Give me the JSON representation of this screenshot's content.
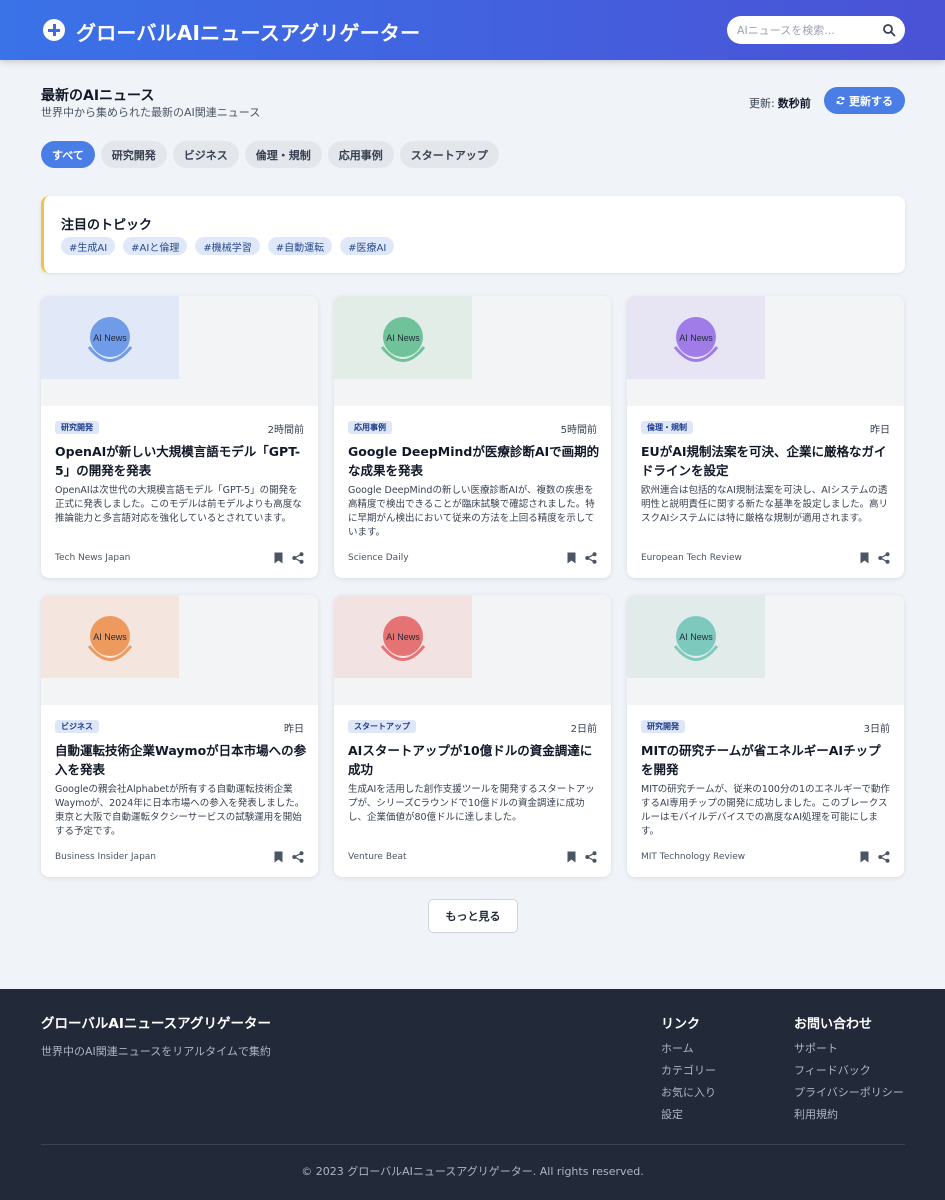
{
  "header": {
    "title": "グローバルAIニュースアグリゲーター",
    "search_placeholder": "AIニュースを検索..."
  },
  "section": {
    "title": "最新のAIニュース",
    "subtitle": "世界中から集められた最新のAI関連ニュース",
    "updated_label": "更新:",
    "updated_value": "数秒前",
    "refresh_label": "更新する"
  },
  "filters": [
    "すべて",
    "研究開発",
    "ビジネス",
    "倫理・規制",
    "応用事例",
    "スタートアップ"
  ],
  "trending": {
    "title": "注目のトピック",
    "tags": [
      "#生成AI",
      "#AIと倫理",
      "#機械学習",
      "#自動運転",
      "#医療AI"
    ]
  },
  "articles": [
    {
      "category": "研究開発",
      "time": "2時間前",
      "title": "OpenAIが新しい大規模言語モデル「GPT-5」の開発を発表",
      "description": "OpenAIは次世代の大規模言語モデル「GPT-5」の開発を正式に発表しました。このモデルは前モデルよりも高度な推論能力と多言語対応を強化しているとされています。",
      "source": "Tech News Japan",
      "thumb_label": "AI News",
      "thumb_bg": "#e1e8f8",
      "thumb_color": "#6f9be8"
    },
    {
      "category": "応用事例",
      "time": "5時間前",
      "title": "Google DeepMindが医療診断AIで画期的な成果を発表",
      "description": "Google DeepMindの新しい医療診断AIが、複数の疾患を高精度で検出できることが臨床試験で確認されました。特に早期がん検出において従来の方法を上回る精度を示しています。",
      "source": "Science Daily",
      "thumb_label": "AI News",
      "thumb_bg": "#e2ede8",
      "thumb_color": "#6fc29a"
    },
    {
      "category": "倫理・規制",
      "time": "昨日",
      "title": "EUがAI規制法案を可決、企業に厳格なガイドラインを設定",
      "description": "欧州連合は包括的なAI規制法案を可決し、AIシステムの透明性と説明責任に関する新たな基準を設定しました。高リスクAIシステムには特に厳格な規制が適用されます。",
      "source": "European Tech Review",
      "thumb_label": "AI News",
      "thumb_bg": "#e7e4f4",
      "thumb_color": "#a07ce8"
    },
    {
      "category": "ビジネス",
      "time": "昨日",
      "title": "自動運転技術企業Waymoが日本市場への参入を発表",
      "description": "Googleの親会社Alphabetが所有する自動運転技術企業Waymoが、2024年に日本市場への参入を発表しました。東京と大阪で自動運転タクシーサービスの試験運用を開始する予定です。",
      "source": "Business Insider Japan",
      "thumb_label": "AI News",
      "thumb_bg": "#f4e6df",
      "thumb_color": "#ee9a5e"
    },
    {
      "category": "スタートアップ",
      "time": "2日前",
      "title": "AIスタートアップが10億ドルの資金調達に成功",
      "description": "生成AIを活用した創作支援ツールを開発するスタートアップが、シリーズCラウンドで10億ドルの資金調達に成功し、企業価値が80億ドルに達しました。",
      "source": "Venture Beat",
      "thumb_label": "AI News",
      "thumb_bg": "#f3e2e2",
      "thumb_color": "#e57373"
    },
    {
      "category": "研究開発",
      "time": "3日前",
      "title": "MITの研究チームが省エネルギーAIチップを開発",
      "description": "MITの研究チームが、従来の100分の1のエネルギーで動作するAI専用チップの開発に成功しました。このブレークスルーはモバイルデバイスでの高度なAI処理を可能にします。",
      "source": "MIT Technology Review",
      "thumb_label": "AI News",
      "thumb_bg": "#e1ecea",
      "thumb_color": "#7ec9bd"
    }
  ],
  "load_more_label": "もっと見る",
  "footer": {
    "brand": "グローバルAIニュースアグリゲーター",
    "tagline": "世界中のAI関連ニュースをリアルタイムで集約",
    "links_title": "リンク",
    "links": [
      "ホーム",
      "カテゴリー",
      "お気に入り",
      "設定"
    ],
    "contact_title": "お問い合わせ",
    "contact_links": [
      "サポート",
      "フィードバック",
      "プライバシーポリシー",
      "利用規約"
    ],
    "copyright": "© 2023 グローバルAIニュースアグリゲーター. All rights reserved."
  }
}
